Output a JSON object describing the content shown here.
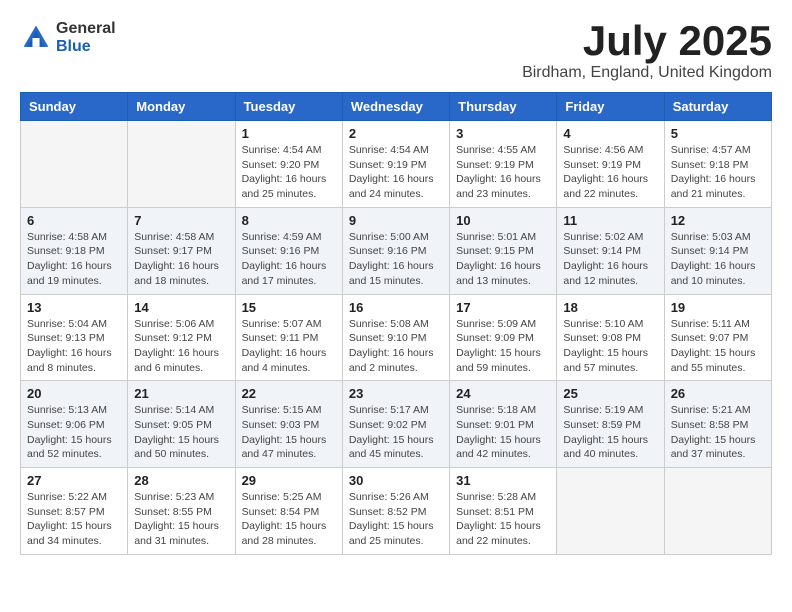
{
  "logo": {
    "general": "General",
    "blue": "Blue"
  },
  "title": "July 2025",
  "location": "Birdham, England, United Kingdom",
  "days_of_week": [
    "Sunday",
    "Monday",
    "Tuesday",
    "Wednesday",
    "Thursday",
    "Friday",
    "Saturday"
  ],
  "weeks": [
    [
      {
        "day": "",
        "sunrise": "",
        "sunset": "",
        "daylight": "",
        "empty": true
      },
      {
        "day": "",
        "sunrise": "",
        "sunset": "",
        "daylight": "",
        "empty": true
      },
      {
        "day": "1",
        "sunrise": "Sunrise: 4:54 AM",
        "sunset": "Sunset: 9:20 PM",
        "daylight": "Daylight: 16 hours and 25 minutes.",
        "empty": false
      },
      {
        "day": "2",
        "sunrise": "Sunrise: 4:54 AM",
        "sunset": "Sunset: 9:19 PM",
        "daylight": "Daylight: 16 hours and 24 minutes.",
        "empty": false
      },
      {
        "day": "3",
        "sunrise": "Sunrise: 4:55 AM",
        "sunset": "Sunset: 9:19 PM",
        "daylight": "Daylight: 16 hours and 23 minutes.",
        "empty": false
      },
      {
        "day": "4",
        "sunrise": "Sunrise: 4:56 AM",
        "sunset": "Sunset: 9:19 PM",
        "daylight": "Daylight: 16 hours and 22 minutes.",
        "empty": false
      },
      {
        "day": "5",
        "sunrise": "Sunrise: 4:57 AM",
        "sunset": "Sunset: 9:18 PM",
        "daylight": "Daylight: 16 hours and 21 minutes.",
        "empty": false
      }
    ],
    [
      {
        "day": "6",
        "sunrise": "Sunrise: 4:58 AM",
        "sunset": "Sunset: 9:18 PM",
        "daylight": "Daylight: 16 hours and 19 minutes.",
        "empty": false
      },
      {
        "day": "7",
        "sunrise": "Sunrise: 4:58 AM",
        "sunset": "Sunset: 9:17 PM",
        "daylight": "Daylight: 16 hours and 18 minutes.",
        "empty": false
      },
      {
        "day": "8",
        "sunrise": "Sunrise: 4:59 AM",
        "sunset": "Sunset: 9:16 PM",
        "daylight": "Daylight: 16 hours and 17 minutes.",
        "empty": false
      },
      {
        "day": "9",
        "sunrise": "Sunrise: 5:00 AM",
        "sunset": "Sunset: 9:16 PM",
        "daylight": "Daylight: 16 hours and 15 minutes.",
        "empty": false
      },
      {
        "day": "10",
        "sunrise": "Sunrise: 5:01 AM",
        "sunset": "Sunset: 9:15 PM",
        "daylight": "Daylight: 16 hours and 13 minutes.",
        "empty": false
      },
      {
        "day": "11",
        "sunrise": "Sunrise: 5:02 AM",
        "sunset": "Sunset: 9:14 PM",
        "daylight": "Daylight: 16 hours and 12 minutes.",
        "empty": false
      },
      {
        "day": "12",
        "sunrise": "Sunrise: 5:03 AM",
        "sunset": "Sunset: 9:14 PM",
        "daylight": "Daylight: 16 hours and 10 minutes.",
        "empty": false
      }
    ],
    [
      {
        "day": "13",
        "sunrise": "Sunrise: 5:04 AM",
        "sunset": "Sunset: 9:13 PM",
        "daylight": "Daylight: 16 hours and 8 minutes.",
        "empty": false
      },
      {
        "day": "14",
        "sunrise": "Sunrise: 5:06 AM",
        "sunset": "Sunset: 9:12 PM",
        "daylight": "Daylight: 16 hours and 6 minutes.",
        "empty": false
      },
      {
        "day": "15",
        "sunrise": "Sunrise: 5:07 AM",
        "sunset": "Sunset: 9:11 PM",
        "daylight": "Daylight: 16 hours and 4 minutes.",
        "empty": false
      },
      {
        "day": "16",
        "sunrise": "Sunrise: 5:08 AM",
        "sunset": "Sunset: 9:10 PM",
        "daylight": "Daylight: 16 hours and 2 minutes.",
        "empty": false
      },
      {
        "day": "17",
        "sunrise": "Sunrise: 5:09 AM",
        "sunset": "Sunset: 9:09 PM",
        "daylight": "Daylight: 15 hours and 59 minutes.",
        "empty": false
      },
      {
        "day": "18",
        "sunrise": "Sunrise: 5:10 AM",
        "sunset": "Sunset: 9:08 PM",
        "daylight": "Daylight: 15 hours and 57 minutes.",
        "empty": false
      },
      {
        "day": "19",
        "sunrise": "Sunrise: 5:11 AM",
        "sunset": "Sunset: 9:07 PM",
        "daylight": "Daylight: 15 hours and 55 minutes.",
        "empty": false
      }
    ],
    [
      {
        "day": "20",
        "sunrise": "Sunrise: 5:13 AM",
        "sunset": "Sunset: 9:06 PM",
        "daylight": "Daylight: 15 hours and 52 minutes.",
        "empty": false
      },
      {
        "day": "21",
        "sunrise": "Sunrise: 5:14 AM",
        "sunset": "Sunset: 9:05 PM",
        "daylight": "Daylight: 15 hours and 50 minutes.",
        "empty": false
      },
      {
        "day": "22",
        "sunrise": "Sunrise: 5:15 AM",
        "sunset": "Sunset: 9:03 PM",
        "daylight": "Daylight: 15 hours and 47 minutes.",
        "empty": false
      },
      {
        "day": "23",
        "sunrise": "Sunrise: 5:17 AM",
        "sunset": "Sunset: 9:02 PM",
        "daylight": "Daylight: 15 hours and 45 minutes.",
        "empty": false
      },
      {
        "day": "24",
        "sunrise": "Sunrise: 5:18 AM",
        "sunset": "Sunset: 9:01 PM",
        "daylight": "Daylight: 15 hours and 42 minutes.",
        "empty": false
      },
      {
        "day": "25",
        "sunrise": "Sunrise: 5:19 AM",
        "sunset": "Sunset: 8:59 PM",
        "daylight": "Daylight: 15 hours and 40 minutes.",
        "empty": false
      },
      {
        "day": "26",
        "sunrise": "Sunrise: 5:21 AM",
        "sunset": "Sunset: 8:58 PM",
        "daylight": "Daylight: 15 hours and 37 minutes.",
        "empty": false
      }
    ],
    [
      {
        "day": "27",
        "sunrise": "Sunrise: 5:22 AM",
        "sunset": "Sunset: 8:57 PM",
        "daylight": "Daylight: 15 hours and 34 minutes.",
        "empty": false
      },
      {
        "day": "28",
        "sunrise": "Sunrise: 5:23 AM",
        "sunset": "Sunset: 8:55 PM",
        "daylight": "Daylight: 15 hours and 31 minutes.",
        "empty": false
      },
      {
        "day": "29",
        "sunrise": "Sunrise: 5:25 AM",
        "sunset": "Sunset: 8:54 PM",
        "daylight": "Daylight: 15 hours and 28 minutes.",
        "empty": false
      },
      {
        "day": "30",
        "sunrise": "Sunrise: 5:26 AM",
        "sunset": "Sunset: 8:52 PM",
        "daylight": "Daylight: 15 hours and 25 minutes.",
        "empty": false
      },
      {
        "day": "31",
        "sunrise": "Sunrise: 5:28 AM",
        "sunset": "Sunset: 8:51 PM",
        "daylight": "Daylight: 15 hours and 22 minutes.",
        "empty": false
      },
      {
        "day": "",
        "sunrise": "",
        "sunset": "",
        "daylight": "",
        "empty": true
      },
      {
        "day": "",
        "sunrise": "",
        "sunset": "",
        "daylight": "",
        "empty": true
      }
    ]
  ]
}
